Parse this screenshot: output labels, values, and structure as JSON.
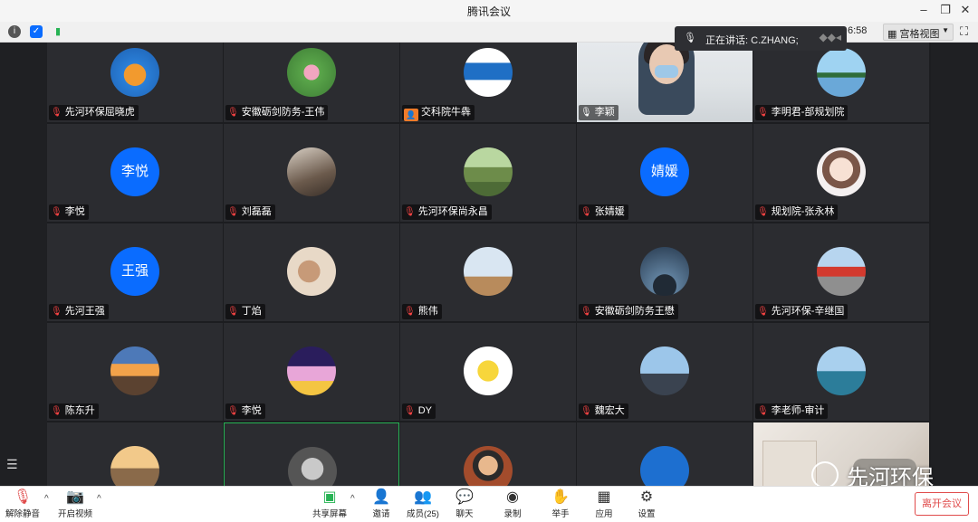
{
  "window": {
    "title": "腾讯会议"
  },
  "speaking": {
    "prefix": "正在讲话:",
    "name": "C.ZHANG;"
  },
  "clock": "6:58",
  "view_button": "宫格视图",
  "participants": [
    {
      "name": "先河环保屈晓虎",
      "avatar_text": "",
      "muted": true,
      "avatar": "gourd"
    },
    {
      "name": "安徽砺剑防务-王伟",
      "avatar_text": "",
      "muted": true,
      "avatar": "lotus"
    },
    {
      "name": "交科院牛犇",
      "avatar_text": "",
      "muted": true,
      "avatar": "logo"
    },
    {
      "name": "李颖",
      "avatar_text": "",
      "muted": false,
      "avatar": "video"
    },
    {
      "name": "李明君-部规划院",
      "avatar_text": "",
      "muted": true,
      "avatar": "lake"
    },
    {
      "name": "李悦",
      "avatar_text": "李悦",
      "muted": true,
      "avatar": "blue"
    },
    {
      "name": "刘磊磊",
      "avatar_text": "",
      "muted": true,
      "avatar": "couple"
    },
    {
      "name": "先河环保尚永昌",
      "avatar_text": "",
      "muted": true,
      "avatar": "house"
    },
    {
      "name": "张婧媛",
      "avatar_text": "婧媛",
      "muted": true,
      "avatar": "blue"
    },
    {
      "name": "规划院-张永林",
      "avatar_text": "",
      "muted": true,
      "avatar": "girl"
    },
    {
      "name": "先河王强",
      "avatar_text": "王强",
      "muted": true,
      "avatar": "blue"
    },
    {
      "name": "丁焰",
      "avatar_text": "",
      "muted": true,
      "avatar": "rabbit"
    },
    {
      "name": "熊伟",
      "avatar_text": "",
      "muted": true,
      "avatar": "elephant"
    },
    {
      "name": "安徽砺剑防务王懋",
      "avatar_text": "",
      "muted": true,
      "avatar": "silhouette"
    },
    {
      "name": "先河环保-辛继国",
      "avatar_text": "",
      "muted": true,
      "avatar": "flag"
    },
    {
      "name": "陈东升",
      "avatar_text": "",
      "muted": true,
      "avatar": "sunset"
    },
    {
      "name": "李悦",
      "avatar_text": "",
      "muted": true,
      "avatar": "art"
    },
    {
      "name": "DY",
      "avatar_text": "",
      "muted": true,
      "avatar": "bart"
    },
    {
      "name": "魏宏大",
      "avatar_text": "",
      "muted": true,
      "avatar": "plane"
    },
    {
      "name": "李老师-审计",
      "avatar_text": "",
      "muted": true,
      "avatar": "sea"
    },
    {
      "name": "",
      "avatar_text": "",
      "muted": true,
      "avatar": "road"
    },
    {
      "name": "",
      "avatar_text": "",
      "muted": true,
      "avatar": "portrait"
    },
    {
      "name": "",
      "avatar_text": "",
      "muted": true,
      "avatar": "kid"
    },
    {
      "name": "",
      "avatar_text": "",
      "muted": true,
      "avatar": "plane2"
    },
    {
      "name": "",
      "avatar_text": "",
      "muted": true,
      "avatar": "video2"
    }
  ],
  "watermark": "先河环保",
  "bottombar": {
    "unmute": "解除静音",
    "start_video": "开启视频",
    "share": "共享屏幕",
    "invite": "邀请",
    "members": "成员(25)",
    "chat": "聊天",
    "record": "录制",
    "raise_hand": "举手",
    "apps": "应用",
    "settings": "设置",
    "leave": "离开会议"
  },
  "colors": {
    "accent": "#0a6cff",
    "muted": "#ff4444",
    "leave": "#e04b4b",
    "active_border": "#27b354"
  }
}
